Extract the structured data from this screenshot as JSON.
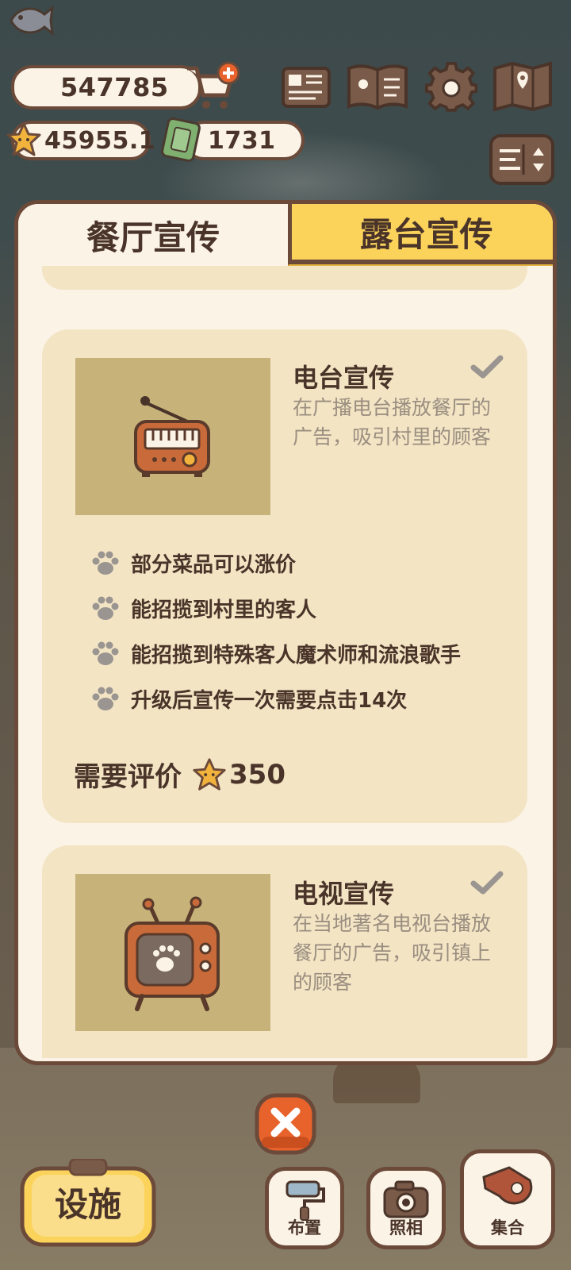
{
  "hud": {
    "fish_count": "547785",
    "star_rating": "45955.1",
    "ticket_count": "1731"
  },
  "tabs": [
    {
      "label": "餐厅宣传",
      "active": true
    },
    {
      "label": "露台宣传",
      "active": false
    }
  ],
  "promotions": [
    {
      "title": "电台宣传",
      "description": "在广播电台播放餐厅的广告，吸引村里的顾客",
      "icon": "radio-icon",
      "features": [
        "部分菜品可以涨价",
        "能招揽到村里的客人",
        "能招揽到特殊客人魔术师和流浪歌手",
        "升级后宣传一次需要点击14次"
      ],
      "requirement_label": "需要评价",
      "requirement_value": "350"
    },
    {
      "title": "电视宣传",
      "description": "在当地著名电视台播放餐厅的广告，吸引镇上的顾客",
      "icon": "tv-icon"
    }
  ],
  "bottom_bar": {
    "facility_label": "设施",
    "layout_label": "布置",
    "photo_label": "照相",
    "gather_label": "集合"
  },
  "colors": {
    "panel_bg": "#fbf3e6",
    "card_bg": "#f3e4c4",
    "border": "#6b4a3a",
    "tab_inactive": "#fbd35b",
    "close_button": "#e8632b",
    "facility_button": "#fbd35b"
  }
}
